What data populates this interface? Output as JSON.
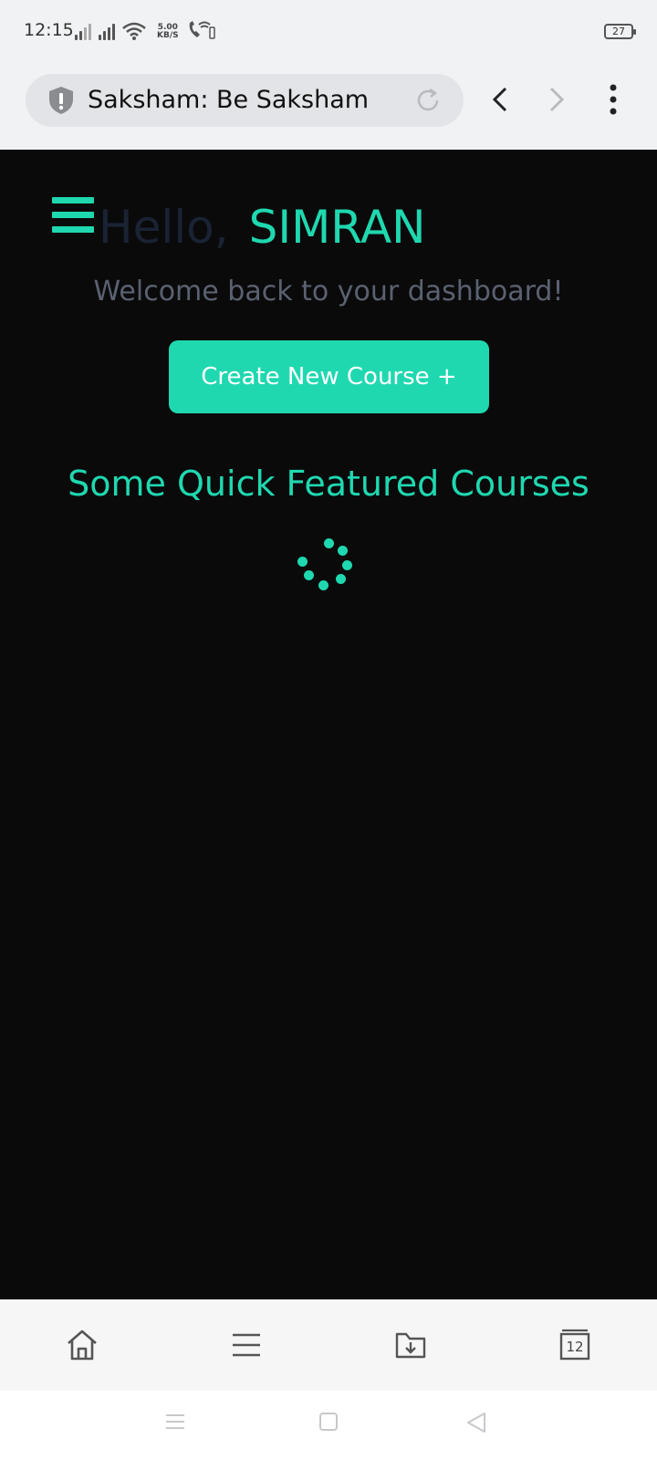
{
  "status_bar": {
    "time": "12:15",
    "speed_value": "5.00",
    "speed_unit": "KB/S",
    "battery": "27"
  },
  "browser": {
    "url_title": "Saksham: Be Saksham",
    "icons": [
      "shield-icon",
      "reload-icon",
      "back-icon",
      "forward-icon",
      "more-icon"
    ]
  },
  "app": {
    "greeting": "Hello,",
    "user_name": "SIMRAN",
    "welcome": "Welcome back to your dashboard!",
    "cta_label": "Create New Course +",
    "featured_heading": "Some Quick Featured Courses",
    "accent_color": "#1fd8b0",
    "background_color": "#0a0a0b"
  },
  "bottom_toolbar": {
    "tabs_count": "12",
    "icons": [
      "home-icon",
      "menu-icon",
      "downloads-icon",
      "tabs-icon"
    ]
  },
  "system_nav": {
    "icons": [
      "recents-icon",
      "home-square-icon",
      "back-triangle-icon"
    ]
  }
}
